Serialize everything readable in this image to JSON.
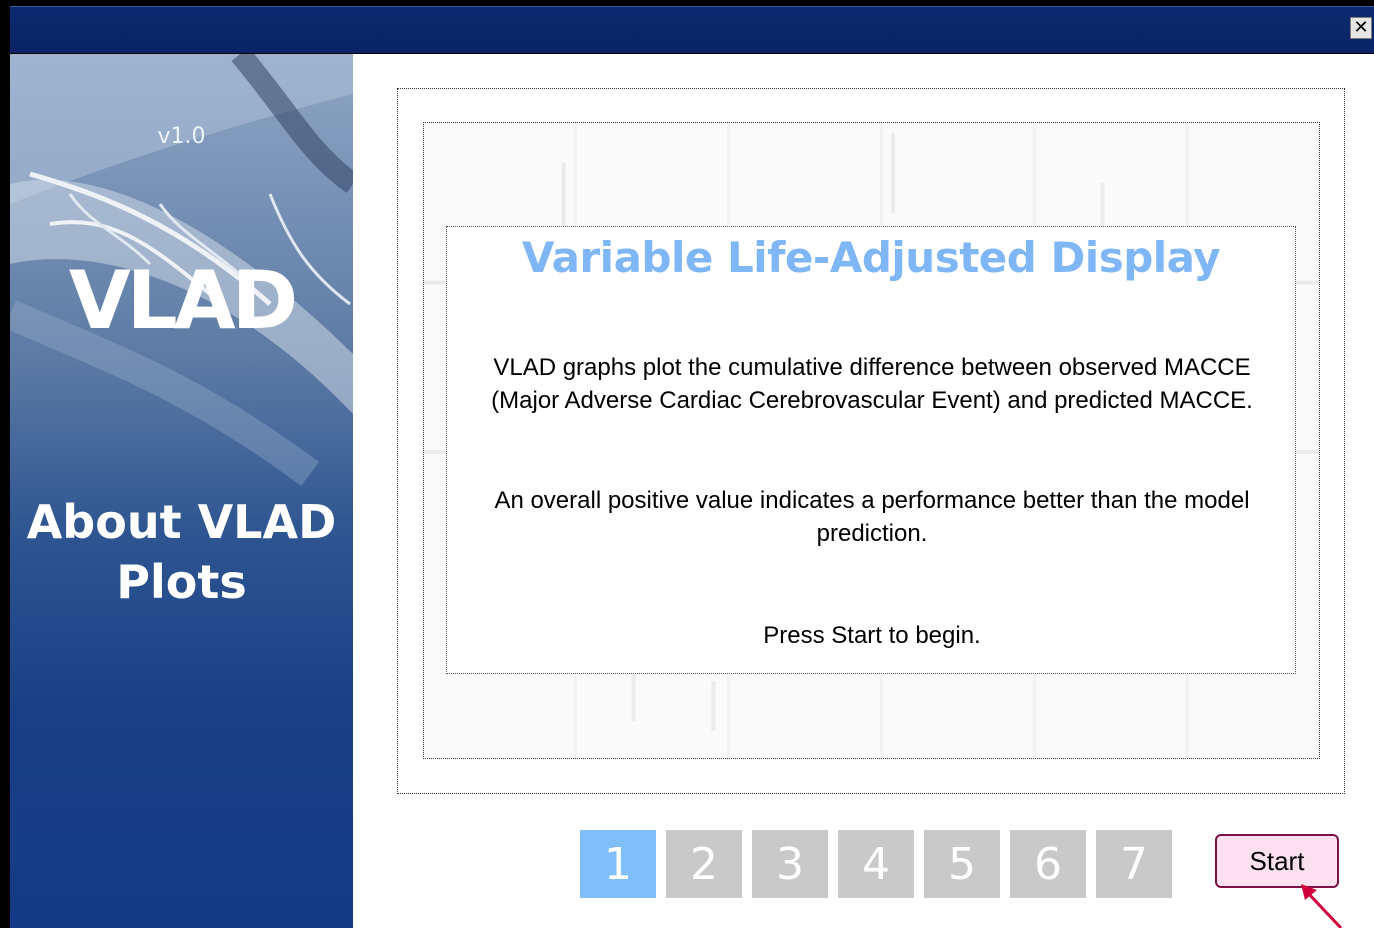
{
  "window": {
    "close_glyph": "✕"
  },
  "sidebar": {
    "version": "v1.0",
    "logo": "VLAD",
    "about_line1": "About VLAD",
    "about_line2": "Plots"
  },
  "content": {
    "heading": "Variable Life-Adjusted Display",
    "paragraph1": "VLAD graphs plot the cumulative difference between observed MACCE (Major Adverse Cardiac Cerebrovascular Event) and predicted MACCE.",
    "paragraph2": "An overall positive value indicates a performance better than the model prediction.",
    "paragraph3": "Press Start to begin."
  },
  "steps": {
    "labels": [
      "1",
      "2",
      "3",
      "4",
      "5",
      "6",
      "7"
    ],
    "active_step": "1"
  },
  "start_button": {
    "label": "Start"
  },
  "colors": {
    "titlebar": "#0a2466",
    "heading": "#7fb6f6",
    "active_step": "#7fbef7",
    "inactive_step": "#c9c9c9",
    "start_bg": "#fde0f0",
    "start_border": "#7c1144"
  }
}
